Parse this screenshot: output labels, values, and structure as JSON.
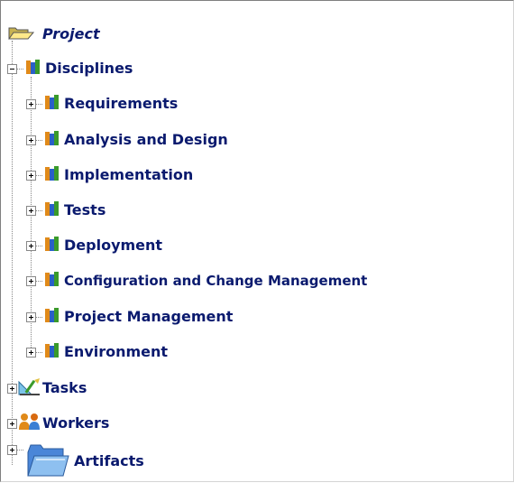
{
  "tree": {
    "root": {
      "label": "Project",
      "icon": "folder-open-icon"
    },
    "disciplines": {
      "label": "Disciplines",
      "icon": "book-stack-icon",
      "children": [
        {
          "label": "Requirements"
        },
        {
          "label": "Analysis and Design"
        },
        {
          "label": "Implementation"
        },
        {
          "label": "Tests"
        },
        {
          "label": "Deployment"
        },
        {
          "label": "Configuration and Change Management"
        },
        {
          "label": "Project Management"
        },
        {
          "label": "Environment"
        }
      ]
    },
    "tasks": {
      "label": "Tasks",
      "icon": "tasks-ruler-icon"
    },
    "workers": {
      "label": "Workers",
      "icon": "workers-people-icon"
    },
    "artifacts": {
      "label": "Artifacts",
      "icon": "folder-blue-icon"
    }
  },
  "colors": {
    "label": "#0a1a6e",
    "connector": "#888888"
  }
}
